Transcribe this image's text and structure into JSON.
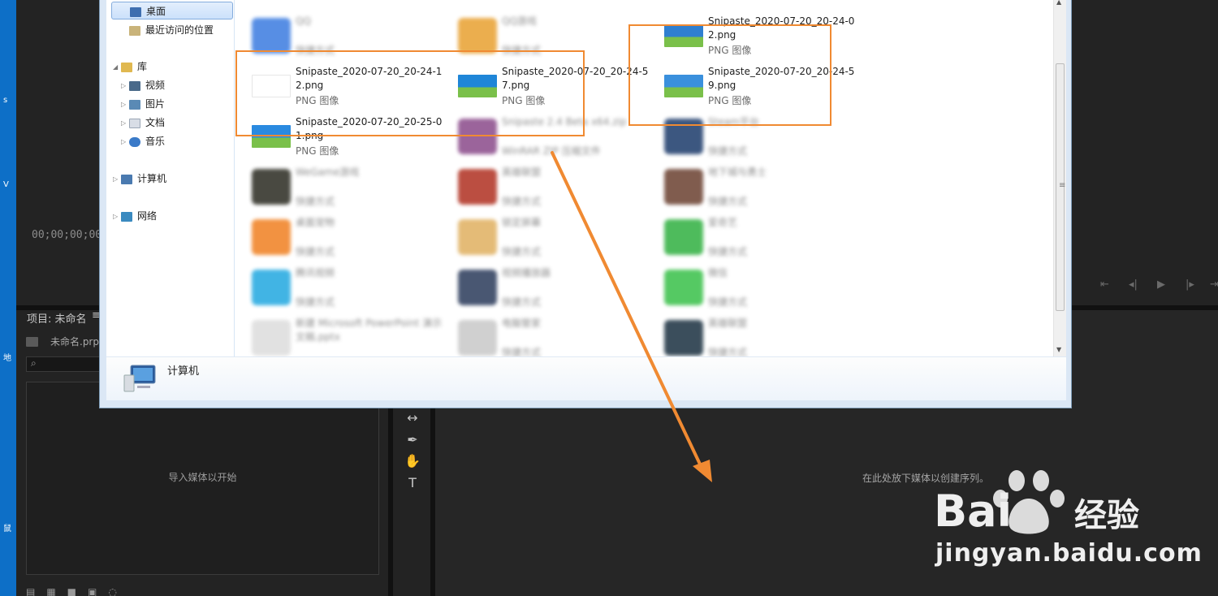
{
  "premiere": {
    "left_strip_chars": [
      "s",
      "V",
      "地",
      "鼠"
    ],
    "timecode": "00;00;00;00",
    "transport_icons": [
      "step-back-icon",
      "frame-back-icon",
      "play-icon",
      "frame-forward-icon",
      "step-forward-icon"
    ],
    "project_title": "项目: 未命名",
    "project_menu": "≡",
    "project_file": "未命名.prp",
    "search_placeholder": "",
    "bin_empty_text": "导入媒体以开始",
    "timeline_empty_text": "在此处放下媒体以创建序列。",
    "tools": [
      "↔",
      "✒",
      "✋",
      "T"
    ]
  },
  "dialog": {
    "nav": [
      {
        "label": "桌面",
        "icon": "desktop-icon",
        "selected": true
      },
      {
        "label": "最近访问的位置",
        "icon": "recent-places-icon"
      },
      {
        "label": "库",
        "icon": "library-icon",
        "expanded": true
      },
      {
        "label": "视频",
        "icon": "video-library-icon"
      },
      {
        "label": "图片",
        "icon": "picture-library-icon"
      },
      {
        "label": "文档",
        "icon": "document-library-icon"
      },
      {
        "label": "音乐",
        "icon": "music-library-icon"
      },
      {
        "label": "计算机",
        "icon": "computer-icon"
      },
      {
        "label": "网络",
        "icon": "network-icon"
      }
    ],
    "files": [
      {
        "name": "QQ",
        "type": "快捷方式",
        "extra": "",
        "blurred": true,
        "thumb": "#3a7be0"
      },
      {
        "name": "QQ游戏",
        "type": "快捷方式",
        "extra": "",
        "blurred": true,
        "thumb": "#e8a030"
      },
      {
        "name": "Snipaste_2020-07-20_20-24-02.png",
        "type": "PNG 图像",
        "extra": "",
        "blurred": false,
        "thumb": "#2f7fd0"
      },
      {
        "name": "Snipaste_2020-07-20_20-24-12.png",
        "type": "PNG 图像",
        "extra": "",
        "blurred": false,
        "thumb": "#ffffff"
      },
      {
        "name": "Snipaste_2020-07-20_20-24-57.png",
        "type": "PNG 图像",
        "extra": "",
        "blurred": false,
        "thumb": "#1f86d8"
      },
      {
        "name": "Snipaste_2020-07-20_20-24-59.png",
        "type": "PNG 图像",
        "extra": "",
        "blurred": false,
        "thumb": "#3a90dd"
      },
      {
        "name": "Snipaste_2020-07-20_20-25-01.png",
        "type": "PNG 图像",
        "extra": "",
        "blurred": false,
        "thumb": "#2a8ae0"
      },
      {
        "name": "Snipaste 2.4 Beta x64.zip",
        "type": "WinRAR ZIP 压缩文件",
        "extra": "",
        "blurred": true,
        "thumb": "#8a4a8a"
      },
      {
        "name": "Steam平台",
        "type": "快捷方式",
        "extra": "",
        "blurred": true,
        "thumb": "#1b3a6a"
      },
      {
        "name": "WeGame游戏",
        "type": "快捷方式",
        "extra": "",
        "blurred": true,
        "thumb": "#2a2a20"
      },
      {
        "name": "英雄联盟",
        "type": "快捷方式",
        "extra": "",
        "blurred": true,
        "thumb": "#b03020"
      },
      {
        "name": "地下城与勇士",
        "type": "快捷方式",
        "extra": "",
        "blurred": true,
        "thumb": "#6a4030"
      },
      {
        "name": "桌面宠物",
        "type": "快捷方式",
        "extra": "",
        "blurred": true,
        "thumb": "#f08020"
      },
      {
        "name": "锁定屏幕",
        "type": "快捷方式",
        "extra": "",
        "blurred": true,
        "thumb": "#e0b060"
      },
      {
        "name": "爱奇艺",
        "type": "快捷方式",
        "extra": "",
        "blurred": true,
        "thumb": "#30b040"
      },
      {
        "name": "腾讯视频",
        "type": "快捷方式",
        "extra": "",
        "blurred": true,
        "thumb": "#20a8e0"
      },
      {
        "name": "视频播放器",
        "type": "快捷方式",
        "extra": "",
        "blurred": true,
        "thumb": "#2a3a5a"
      },
      {
        "name": "微信",
        "type": "快捷方式",
        "extra": "",
        "blurred": true,
        "thumb": "#38c048"
      },
      {
        "name": "新建 Microsoft PowerPoint 演示文稿.pptx",
        "type": "",
        "extra": "",
        "blurred": true,
        "thumb": "#dcdcdc"
      },
      {
        "name": "电脑管家",
        "type": "快捷方式",
        "extra": "",
        "blurred": true,
        "thumb": "#c8c8c8"
      },
      {
        "name": "英雄联盟",
        "type": "快捷方式",
        "extra": "",
        "blurred": true,
        "thumb": "#1a3040"
      }
    ],
    "details_label": "计算机"
  },
  "watermark": {
    "text": "jingyan.baidu.com",
    "logo_text": "Bai  经验"
  },
  "colors": {
    "accent": "#f08a32",
    "panel": "#232323",
    "dialog_border": "#7f9db9"
  }
}
